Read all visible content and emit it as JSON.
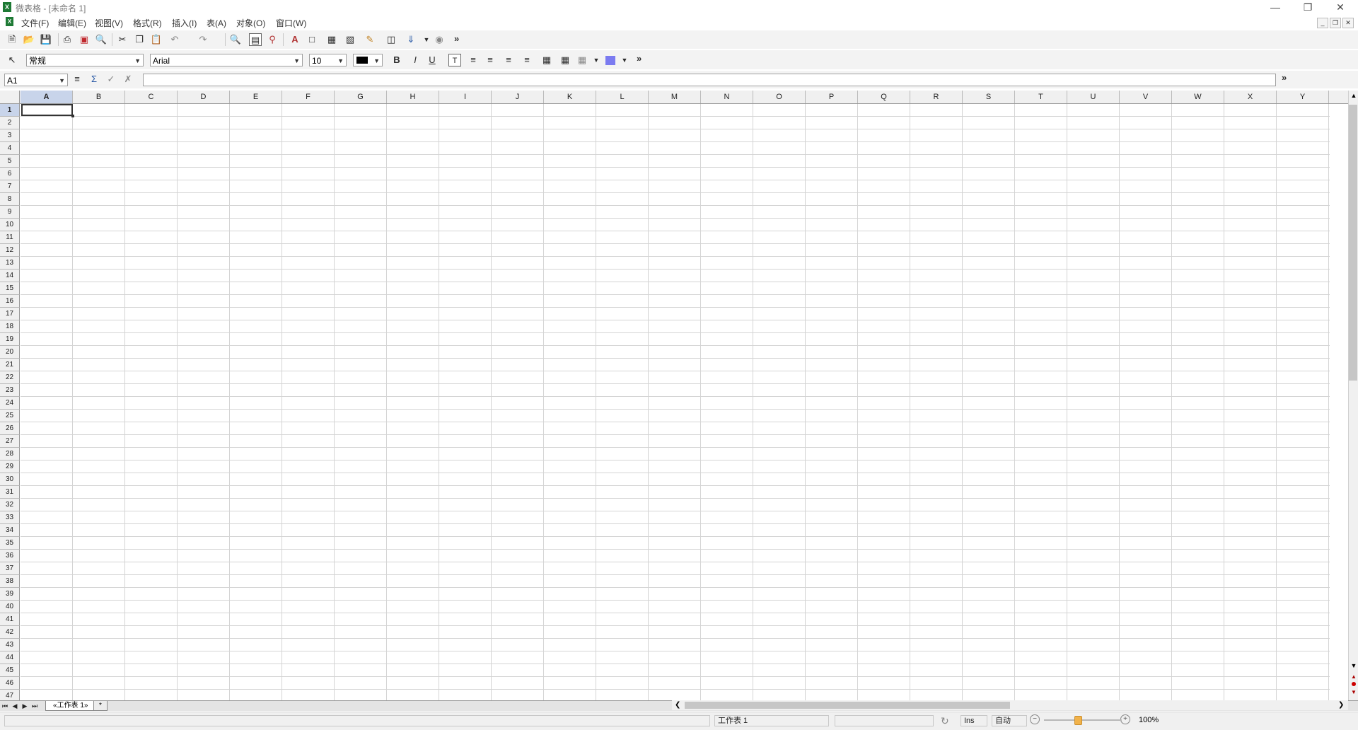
{
  "window": {
    "title": "微表格 - [未命名 1]",
    "app_icon_letter": "X",
    "controls": [
      "minimize-icon",
      "restore-icon",
      "close-icon"
    ]
  },
  "menu": {
    "items": [
      "文件(F)",
      "编辑(E)",
      "视图(V)",
      "格式(R)",
      "插入(I)",
      "表(A)",
      "对象(O)",
      "窗口(W)"
    ],
    "mdi_controls": [
      "_",
      "❐",
      "✕"
    ]
  },
  "toolbar1": {
    "icons": [
      "new-document-icon",
      "open-folder-icon",
      "save-icon",
      "print-icon",
      "pdf-export-icon",
      "print-preview-icon",
      "cut-icon",
      "copy-icon",
      "paste-icon",
      "undo-icon",
      "redo-icon",
      "find-icon",
      "chart-icon",
      "zoom-icon",
      "text-frame-icon",
      "crop-icon",
      "grid-icon",
      "hatch-icon",
      "format-painter-icon",
      "column-icon",
      "insert-icon",
      "object-icon"
    ],
    "overflow": "»"
  },
  "toolbar2": {
    "style_combo": "常规",
    "font_combo": "Arial",
    "size_combo": "10",
    "color_swatch": "#000000",
    "fill_swatch": "#7b7bf0",
    "overflow": "»"
  },
  "formula_bar": {
    "cell_ref": "A1",
    "value": "",
    "overflow": "»"
  },
  "sheet": {
    "columns": [
      "A",
      "B",
      "C",
      "D",
      "E",
      "F",
      "G",
      "H",
      "I",
      "J",
      "K",
      "L",
      "M",
      "N",
      "O",
      "P",
      "Q",
      "R",
      "S",
      "T",
      "U",
      "V",
      "W",
      "X",
      "Y"
    ],
    "rows": [
      "1",
      "2",
      "3",
      "4",
      "5",
      "6",
      "7",
      "8",
      "9",
      "10",
      "11",
      "12",
      "13",
      "14",
      "15",
      "16",
      "17",
      "18",
      "19",
      "20",
      "21",
      "22",
      "23",
      "24",
      "25",
      "26",
      "27",
      "28",
      "29",
      "30",
      "31",
      "32",
      "33",
      "34",
      "35",
      "36",
      "37",
      "38",
      "39",
      "40",
      "41",
      "42",
      "43",
      "44",
      "45",
      "46",
      "47"
    ],
    "active_column": "A",
    "active_row": "1"
  },
  "tabs": {
    "nav": [
      "⏮",
      "◀",
      "▶",
      "⏭"
    ],
    "sheet_label": "«工作表 1»",
    "new_tab_label": "*"
  },
  "status": {
    "sheet_name": "工作表 1",
    "ins": "Ins",
    "mode": "自动",
    "zoom_percent": "100%",
    "zoom_minus": "−",
    "zoom_plus": "+"
  }
}
